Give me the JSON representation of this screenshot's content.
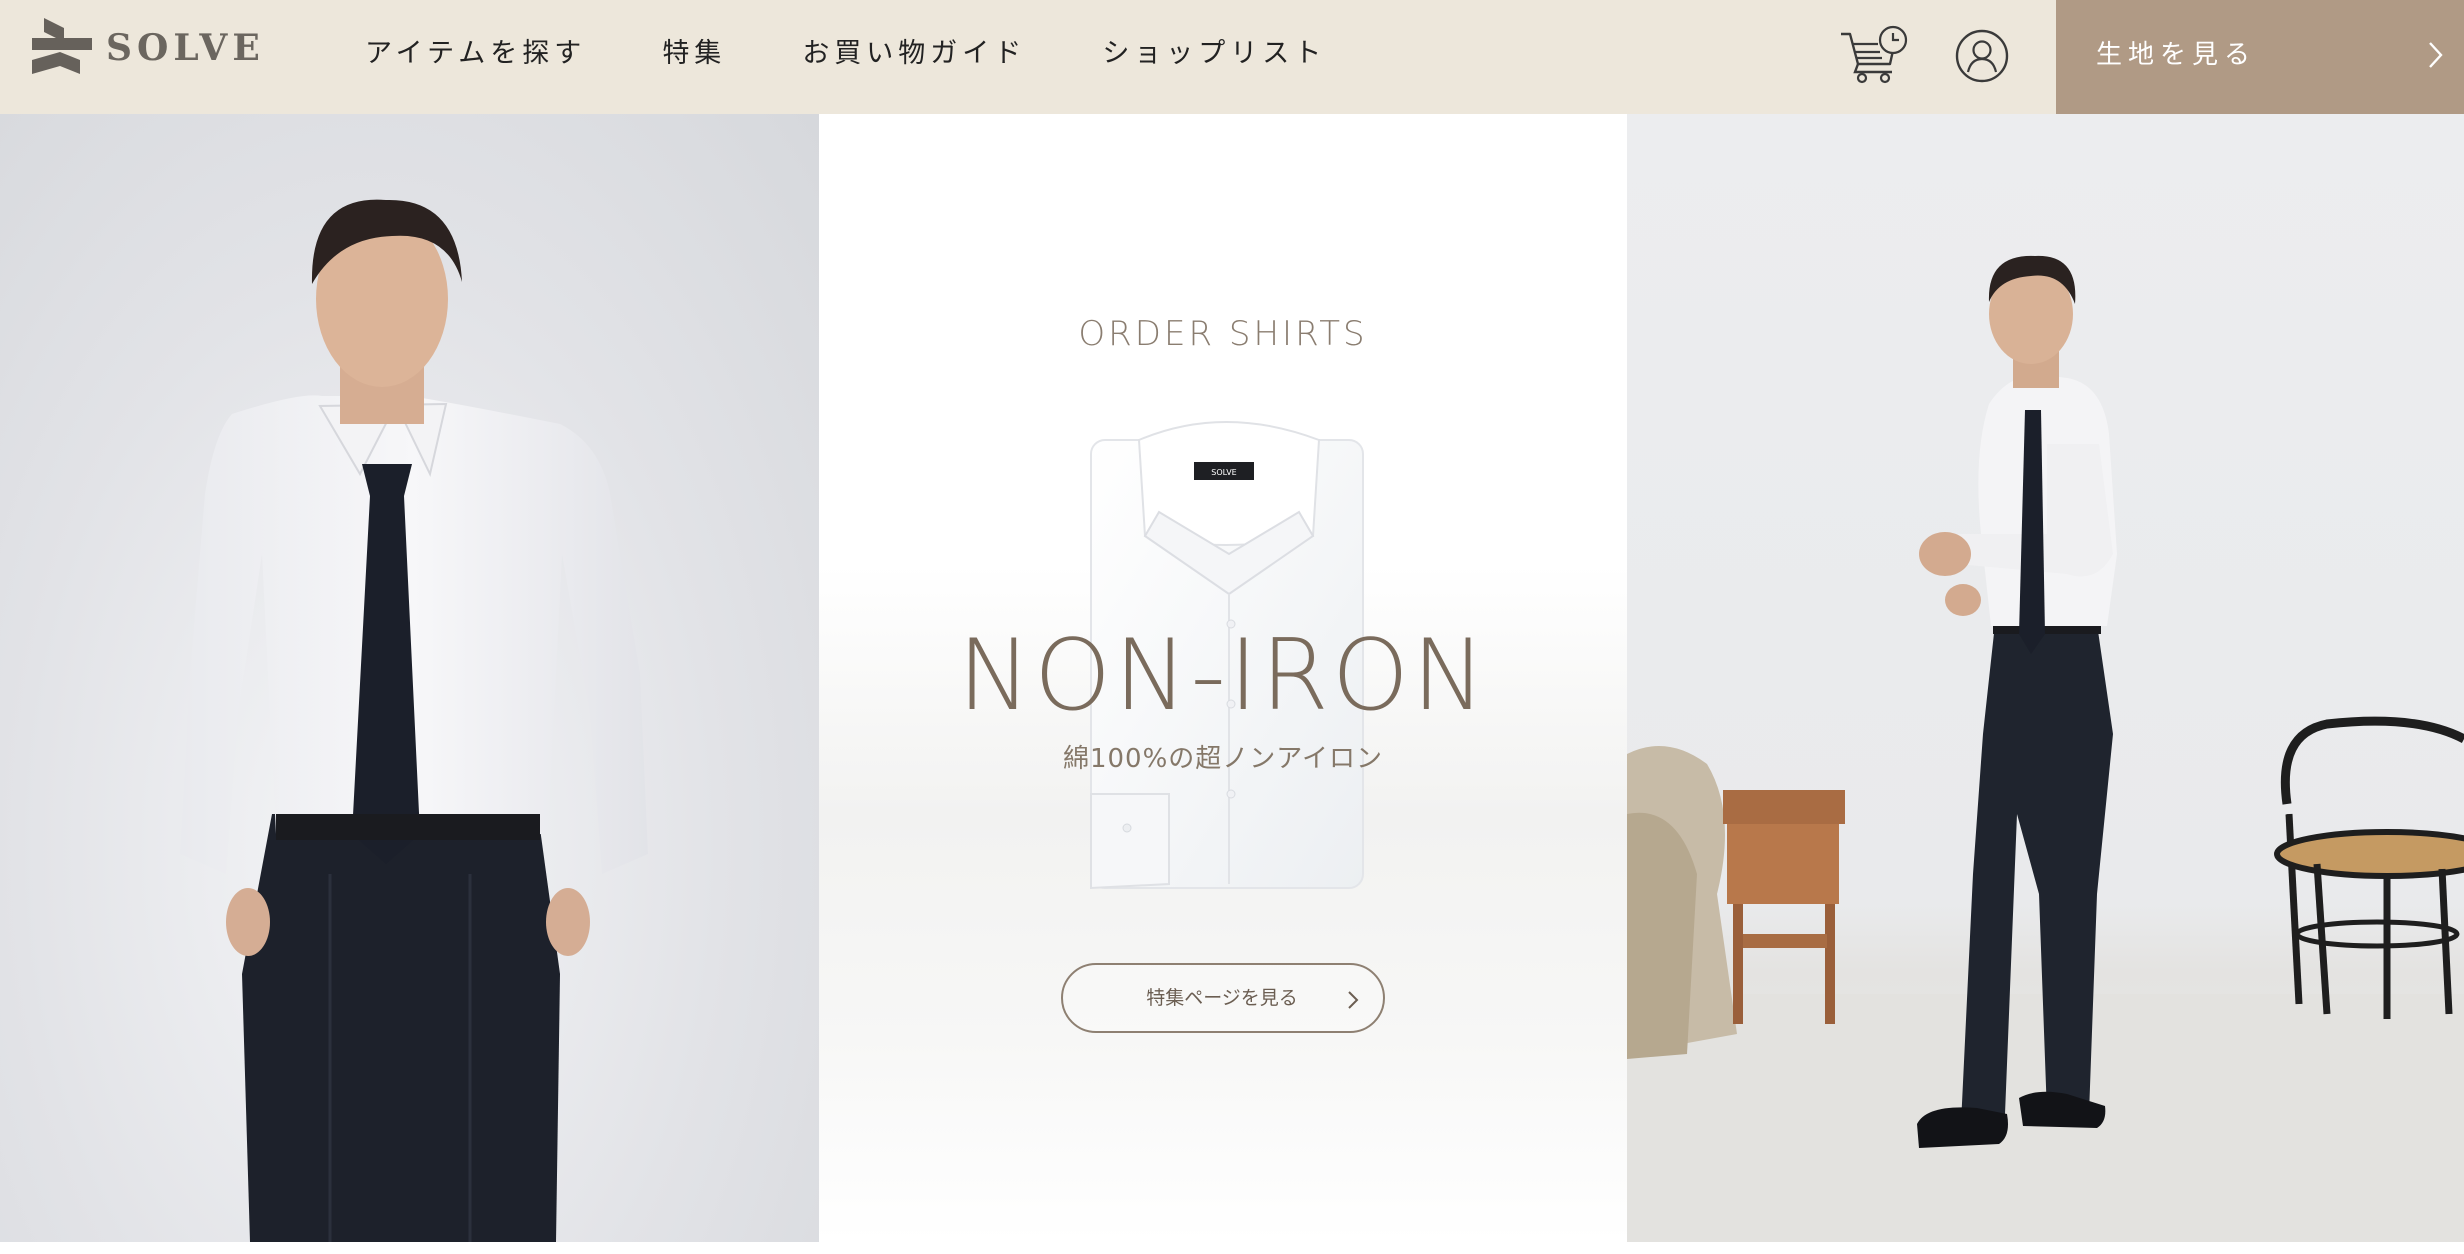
{
  "header": {
    "brand": "SOLVE",
    "nav": [
      {
        "label": "アイテムを探す"
      },
      {
        "label": "特集"
      },
      {
        "label": "お買い物ガイド"
      },
      {
        "label": "ショップリスト"
      }
    ],
    "fabric_button": "生地を見る"
  },
  "hero": {
    "eyebrow": "ORDER SHIRTS",
    "title": "NON-IRON",
    "subtitle": "綿100%の超ノンアイロン",
    "cta": "特集ページを見る",
    "shirt_tag": "SOLVE"
  },
  "icons": {
    "logo": "solve-logo-mark",
    "cart": "cart-with-clock-icon",
    "user": "user-circle-icon",
    "chevron": "chevron-right-icon"
  },
  "colors": {
    "header_bg": "#ede7db",
    "accent_button": "#b09a85",
    "title_brown": "#7a6b5c",
    "nav_text": "#222222"
  }
}
